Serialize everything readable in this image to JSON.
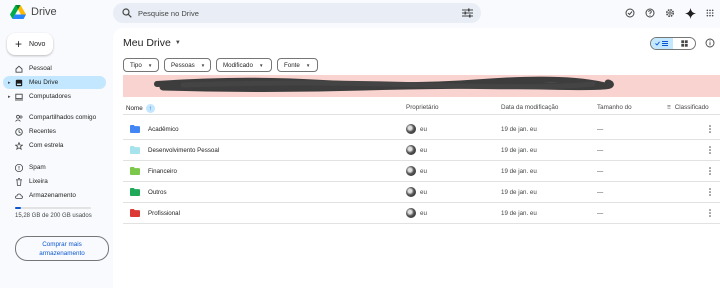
{
  "app": {
    "name": "Drive"
  },
  "search": {
    "placeholder": "Pesquise no Drive"
  },
  "sidebar": {
    "new_label": "Novo",
    "items": [
      {
        "label": "Pessoal",
        "icon": "home-icon"
      },
      {
        "label": "Meu Drive",
        "icon": "my-drive-icon",
        "active": true
      },
      {
        "label": "Computadores",
        "icon": "computer-icon"
      },
      {
        "label": "Compartilhados comigo",
        "icon": "shared-icon"
      },
      {
        "label": "Recentes",
        "icon": "clock-icon"
      },
      {
        "label": "Com estrela",
        "icon": "star-icon"
      },
      {
        "label": "Spam",
        "icon": "spam-icon"
      },
      {
        "label": "Lixeira",
        "icon": "trash-icon"
      },
      {
        "label": "Armazenamento",
        "icon": "cloud-icon"
      }
    ],
    "storage_text": "15,28 GB de 200 GB usados",
    "storage_fraction": 0.076,
    "buy_label": "Comprar mais armazenamento"
  },
  "main": {
    "title": "Meu Drive",
    "filters": [
      "Tipo",
      "Pessoas",
      "Modificado",
      "Fonte"
    ],
    "columns": {
      "name": "Nome",
      "owner": "Proprietário",
      "modified": "Data da modificação",
      "size": "Tamanho do",
      "sort": "Classificado"
    },
    "rows": [
      {
        "name": "Acadêmico",
        "color": "#4285f4",
        "owner": "eu",
        "modified": "19 de jan. eu",
        "size": "—"
      },
      {
        "name": "Desenvolvimento Pessoal",
        "color": "#a6e3ec",
        "owner": "eu",
        "modified": "19 de jan. eu",
        "size": "—"
      },
      {
        "name": "Financeiro",
        "color": "#7cc84a",
        "owner": "eu",
        "modified": "19 de jan. eu",
        "size": "—"
      },
      {
        "name": "Outros",
        "color": "#21a95a",
        "owner": "eu",
        "modified": "19 de jan. eu",
        "size": "—"
      },
      {
        "name": "Profissional",
        "color": "#db3a34",
        "owner": "eu",
        "modified": "19 de jan. eu",
        "size": "—"
      }
    ]
  }
}
